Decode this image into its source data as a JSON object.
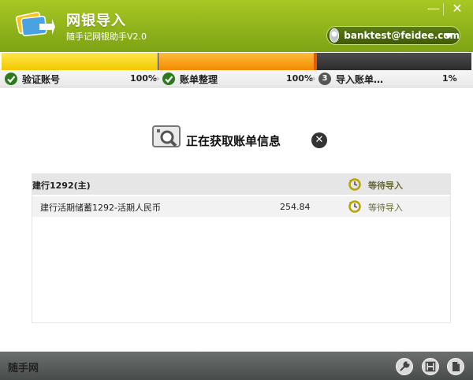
{
  "header": {
    "title": "网银导入",
    "subtitle": "随手记网银助手V2.0",
    "minimize_label": "—",
    "close_label": "✕",
    "account_email": "banktest@feidee.com"
  },
  "steps": [
    {
      "label": "验证账号",
      "percent": "100%",
      "state": "done"
    },
    {
      "label": "账单整理",
      "percent": "100%",
      "state": "done"
    },
    {
      "number": "3",
      "label": "导入账单…",
      "percent": "1%",
      "state": "active"
    }
  ],
  "status": {
    "message": "正在获取账单信息",
    "cancel_label": "✕"
  },
  "list": {
    "group": {
      "name": "建行1292(主)",
      "state": "等待导入"
    },
    "items": [
      {
        "name": "建行活期储蓄1292-活期人民币",
        "amount": "254.84",
        "state": "等待导入"
      }
    ]
  },
  "footer": {
    "brand": "随手网"
  },
  "colors": {
    "header_green": "#8fb31a",
    "progress_yellow": "#f2c800",
    "progress_orange": "#f28b00",
    "footer_gray": "#555a58"
  }
}
